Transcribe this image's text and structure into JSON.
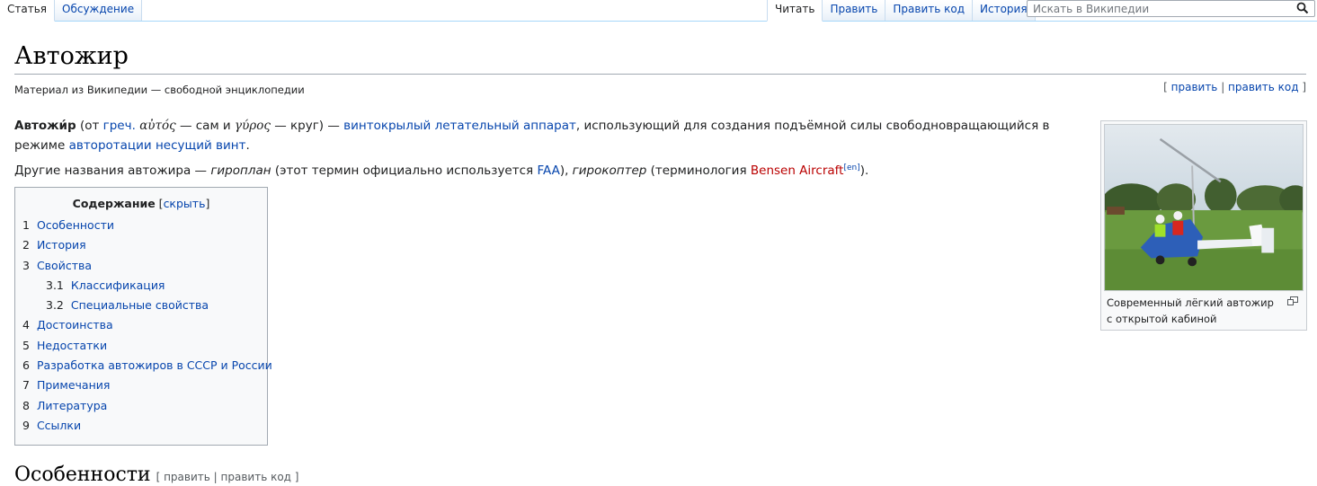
{
  "tabs_left": [
    {
      "label": "Статья",
      "selected": true
    },
    {
      "label": "Обсуждение",
      "selected": false
    }
  ],
  "tabs_right": [
    {
      "label": "Читать",
      "selected": true
    },
    {
      "label": "Править",
      "selected": false
    },
    {
      "label": "Править код",
      "selected": false
    },
    {
      "label": "История",
      "selected": false
    }
  ],
  "search": {
    "placeholder": "Искать в Википедии",
    "value": "",
    "icon": "search-icon"
  },
  "page": {
    "title": "Автожир",
    "tagline": "Материал из Википедии — свободной энциклопедии",
    "edit": {
      "open": "[ ",
      "edit": "править",
      "sep": " | ",
      "edit_code": "править код",
      "close": " ]"
    }
  },
  "intro": {
    "p1": {
      "bold": "Автожи́р",
      "t1": " (от ",
      "lang": "греч.",
      "t2": " ",
      "greek1": "αὐτός",
      "t3": " — сам и ",
      "greek2": "γύρος",
      "t4": " — круг) — ",
      "link1": "винтокрылый летательный аппарат",
      "t5": ", использующий для создания подъёмной силы свободновращающийся в режиме ",
      "link2": "авторотации",
      "t6": " ",
      "link3": "несущий винт",
      "t7": "."
    },
    "p2": {
      "t1": "Другие названия автожира — ",
      "i1": "гироплан",
      "t2": " (этот термин официально используется ",
      "link1": "FAA",
      "t3": "), ",
      "i2": "гирокоптер",
      "t4": " (терминология ",
      "redlink": "Bensen Aircraft",
      "sup": "[en]",
      "t5": ")."
    }
  },
  "toc": {
    "title": "Содержание",
    "toggle_open": " [",
    "toggle": "скрыть",
    "toggle_close": "]",
    "items": [
      {
        "num": "1",
        "label": "Особенности",
        "level": 1
      },
      {
        "num": "2",
        "label": "История",
        "level": 1
      },
      {
        "num": "3",
        "label": "Свойства",
        "level": 1
      },
      {
        "num": "3.1",
        "label": "Классификация",
        "level": 2
      },
      {
        "num": "3.2",
        "label": "Специальные свойства",
        "level": 2
      },
      {
        "num": "4",
        "label": "Достоинства",
        "level": 1
      },
      {
        "num": "5",
        "label": "Недостатки",
        "level": 1
      },
      {
        "num": "6",
        "label": "Разработка автожиров в СССР и России",
        "level": 1
      },
      {
        "num": "7",
        "label": "Примечания",
        "level": 1
      },
      {
        "num": "8",
        "label": "Литература",
        "level": 1
      },
      {
        "num": "9",
        "label": "Ссылки",
        "level": 1
      }
    ]
  },
  "thumb": {
    "caption": "Современный лёгкий автожир с открытой кабиной",
    "icon": "magnify-icon"
  },
  "section": {
    "title": "Особенности",
    "edit": "[ править | править код ]"
  },
  "colors": {
    "link": "#0645ad",
    "redlink": "#ba0000",
    "tab_border": "#a7d7f9"
  }
}
